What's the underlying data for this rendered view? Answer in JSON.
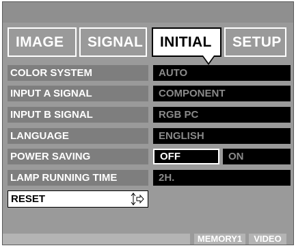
{
  "tabs": [
    {
      "label": "IMAGE"
    },
    {
      "label": "SIGNAL"
    },
    {
      "label": "INITIAL"
    },
    {
      "label": "SETUP"
    }
  ],
  "settings": [
    {
      "label": "COLOR SYSTEM",
      "value": "AUTO"
    },
    {
      "label": "INPUT A SIGNAL",
      "value": "COMPONENT"
    },
    {
      "label": "INPUT B SIGNAL",
      "value": "RGB PC"
    },
    {
      "label": "LANGUAGE",
      "value": "ENGLISH"
    },
    {
      "label": "POWER SAVING",
      "options": [
        "OFF",
        "ON"
      ],
      "selected": "OFF"
    },
    {
      "label": "LAMP RUNNING TIME",
      "value": "2H."
    }
  ],
  "reset": {
    "label": "RESET",
    "icon": "up-down-right-arrow-icon"
  },
  "status": {
    "memory": "MEMORY1",
    "source": "VIDEO"
  },
  "colors": {
    "panel": "#9a9a9a",
    "label_bg": "#7e7e7e",
    "value_bg": "#000000",
    "value_text": "#8a8a8a"
  }
}
